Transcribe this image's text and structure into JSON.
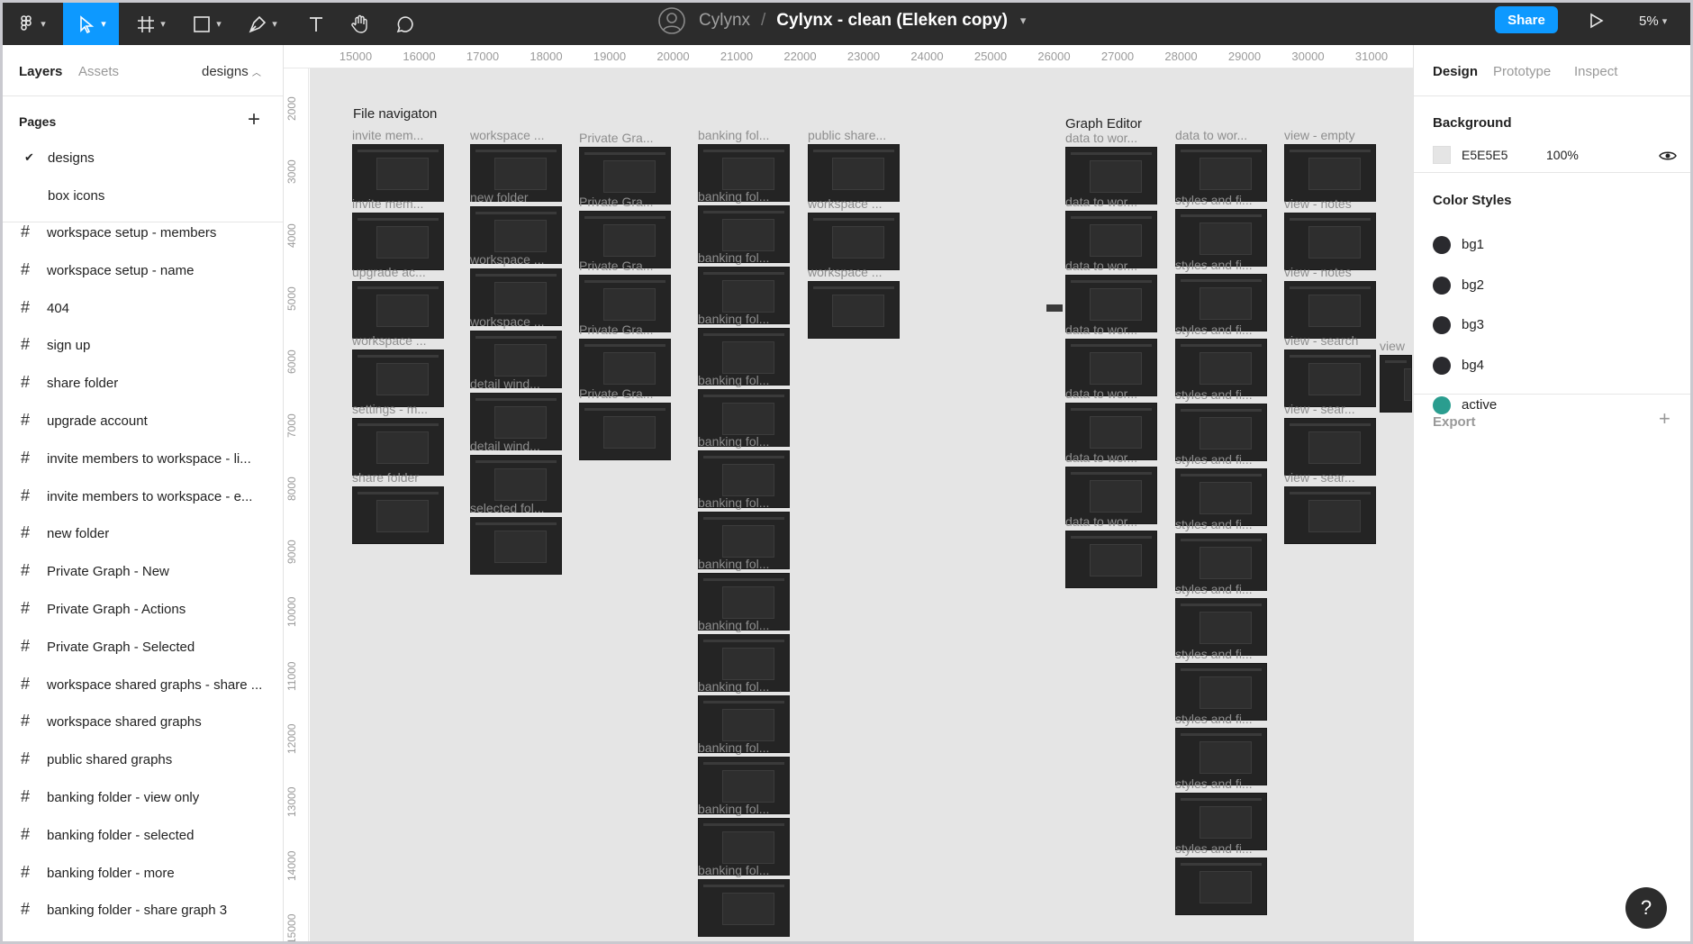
{
  "toolbar": {
    "file_project": "Cylynx",
    "file_separator": "/",
    "file_name": "Cylynx - clean (Eleken copy)",
    "share_label": "Share",
    "zoom_label": "5%"
  },
  "left_panel": {
    "tabs": [
      "Layers",
      "Assets"
    ],
    "page_selector": "designs",
    "pages_title": "Pages",
    "pages": [
      "designs",
      "box icons"
    ],
    "layers": [
      "workspace setup - members",
      "workspace setup - name",
      "404",
      "sign up",
      "share folder",
      "upgrade account",
      "invite members to workspace - li...",
      "invite members to workspace - e...",
      "new folder",
      "Private Graph - New",
      "Private Graph - Actions",
      "Private Graph - Selected",
      "workspace shared graphs - share ...",
      "workspace shared graphs",
      "public shared graphs",
      "banking folder - view only",
      "banking folder - selected",
      "banking folder - more",
      "banking folder - share graph 3"
    ]
  },
  "ruler": {
    "top": [
      "15000",
      "16000",
      "17000",
      "18000",
      "19000",
      "20000",
      "21000",
      "22000",
      "23000",
      "24000",
      "25000",
      "26000",
      "27000",
      "28000",
      "29000",
      "30000",
      "31000"
    ],
    "left": [
      "2000",
      "3000",
      "4000",
      "5000",
      "6000",
      "7000",
      "8000",
      "9000",
      "10000",
      "11000",
      "12000",
      "13000",
      "14000",
      "15000"
    ]
  },
  "canvas": {
    "sections": [
      "File navigaton",
      "Graph Editor"
    ],
    "frame_labels": {
      "col1": [
        "invite mem...",
        "invite mem...",
        "upgrade ac...",
        "workspace ...",
        "settings - m...",
        "share folder"
      ],
      "col2": [
        "workspace ...",
        "new folder",
        "workspace ...",
        "workspace ...",
        "detail wind...",
        "detail wind...",
        "selected fol..."
      ],
      "col3": [
        "Private Gra...",
        "Private Gra...",
        "Private Gra...",
        "Private Gra...",
        "Private Gra..."
      ],
      "col4": [
        "banking fol...",
        "banking fol...",
        "banking fol...",
        "banking fol...",
        "banking fol...",
        "banking fol...",
        "banking fol...",
        "banking fol...",
        "banking fol...",
        "banking fol...",
        "banking fol...",
        "banking fol...",
        "banking fol..."
      ],
      "col5": [
        "public share...",
        "workspace ...",
        "workspace ..."
      ],
      "col6": [
        "data to wor...",
        "data to wor...",
        "data to wor...",
        "data to wor...",
        "data to wor...",
        "data to wor...",
        "data to wor..."
      ],
      "col7": [
        "data to wor...",
        "styles and fi...",
        "styles and fi...",
        "styles and fi...",
        "styles and fi...",
        "styles and fi...",
        "styles and fi...",
        "styles and fi...",
        "styles and fi...",
        "styles and fi...",
        "styles and fi...",
        "styles and fi..."
      ],
      "col8": [
        "view - empty",
        "view - notes",
        "view - notes",
        "view - search",
        "view - sear...",
        "view - sear..."
      ],
      "col9": [
        "view"
      ]
    }
  },
  "right_panel": {
    "tabs": [
      "Design",
      "Prototype",
      "Inspect"
    ],
    "background_title": "Background",
    "background_hex": "E5E5E5",
    "background_opacity": "100%",
    "color_styles_title": "Color Styles",
    "color_styles": [
      {
        "name": "bg1",
        "color": "#2a2a2e"
      },
      {
        "name": "bg2",
        "color": "#2a2a2e"
      },
      {
        "name": "bg3",
        "color": "#2a2a2e"
      },
      {
        "name": "bg4",
        "color": "#2a2a2e"
      },
      {
        "name": "active",
        "color": "#2a9d8f"
      }
    ],
    "export_title": "Export"
  },
  "help_label": "?",
  "colors": {
    "accent": "#0d99ff",
    "toolbar_bg": "#2c2c2c",
    "canvas_bg": "#e5e5e5"
  }
}
